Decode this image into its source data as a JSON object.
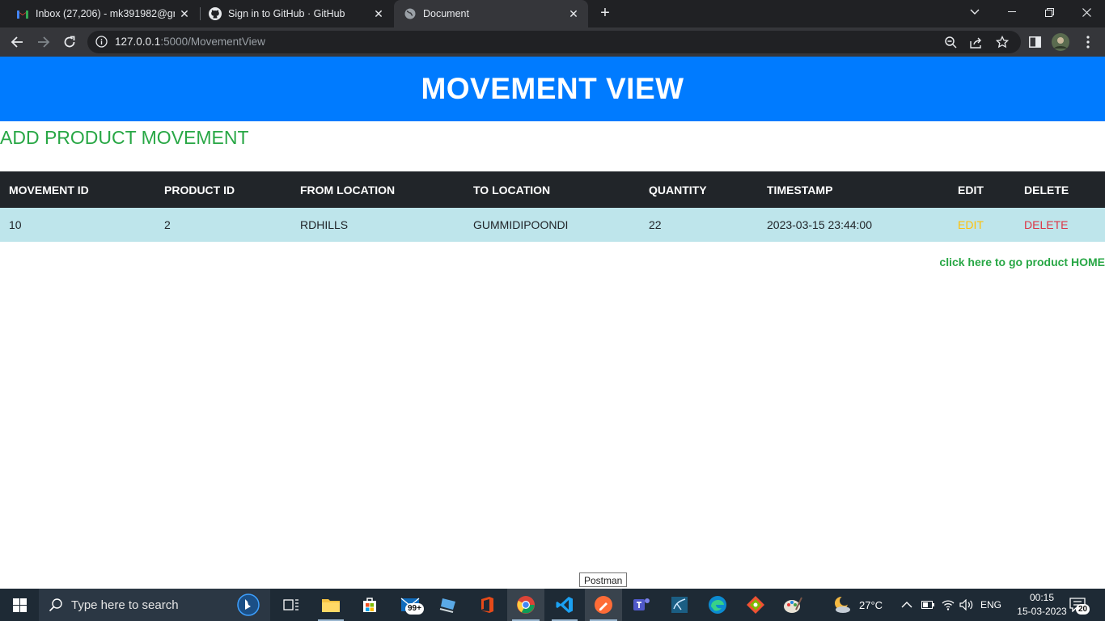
{
  "browser": {
    "tabs": [
      {
        "title": "Inbox (27,206) - mk391982@gmail.com - Gmail",
        "icon": "gmail-icon"
      },
      {
        "title": "Sign in to GitHub · GitHub",
        "icon": "github-icon"
      },
      {
        "title": "Document",
        "icon": "globe-icon"
      }
    ],
    "url_host": "127.0.0.1",
    "url_rest": ":5000/MovementView"
  },
  "page": {
    "heading": "MOVEMENT VIEW",
    "add_link": "ADD PRODUCT MOVEMENT",
    "columns": [
      "MOVEMENT ID",
      "PRODUCT ID",
      "FROM LOCATION",
      "TO LOCATION",
      "QUANTITY",
      "TIMESTAMP",
      "EDIT",
      "DELETE"
    ],
    "rows": [
      {
        "movement_id": "10",
        "product_id": "2",
        "from_location": "RDHILLS",
        "to_location": "GUMMIDIPOONDI",
        "quantity": "22",
        "timestamp": "2023-03-15 23:44:00",
        "edit": "EDIT",
        "delete": "DELETE"
      }
    ],
    "home_link": "click here to go product HOME"
  },
  "tooltip": "Postman",
  "taskbar": {
    "search_placeholder": "Type here to search",
    "mail_badge": "99+",
    "weather": "27°C",
    "language": "ENG",
    "time": "00:15",
    "date": "15-03-2023",
    "notifications": "20"
  },
  "colors": {
    "banner": "#007bff",
    "link_green": "#28a745",
    "table_header": "#212529",
    "row_info": "#bee5eb",
    "edit": "#ffc107",
    "delete": "#dc3545"
  }
}
